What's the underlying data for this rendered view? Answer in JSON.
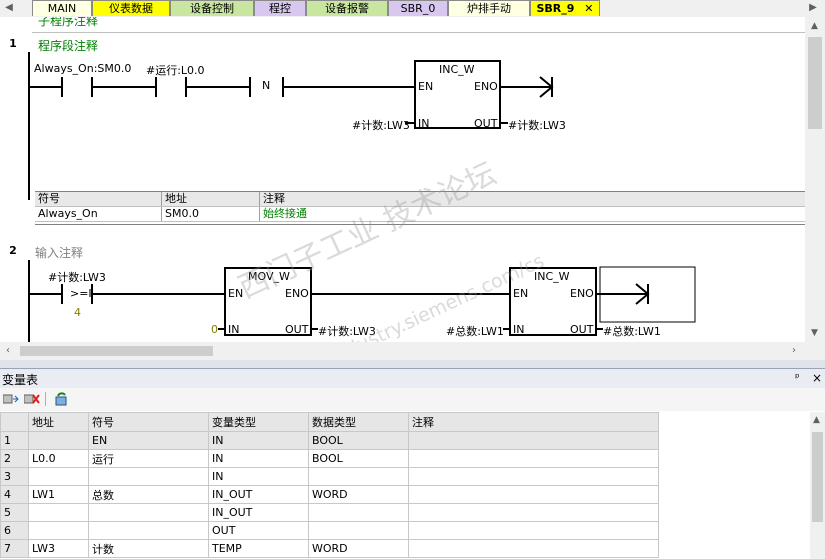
{
  "tabs": [
    {
      "label": "MAIN",
      "bg": "#ffffe1"
    },
    {
      "label": "仪表数据",
      "bg": "#ffff00"
    },
    {
      "label": "设备控制",
      "bg": "#c8e6a0"
    },
    {
      "label": "程控",
      "bg": "#d8c8f0"
    },
    {
      "label": "设备报警",
      "bg": "#c8e6a0"
    },
    {
      "label": "SBR_0",
      "bg": "#d8c8f0"
    },
    {
      "label": "炉排手动",
      "bg": "#ffffe1"
    },
    {
      "label": "SBR_9",
      "bg": "#ffff00"
    }
  ],
  "editor": {
    "top_partial_comment": "子程序注释",
    "network1": {
      "number": "1",
      "comment": "程序段注释",
      "contact1_label": "Always_On:SM0.0",
      "contact2_label": "#运行:L0.0",
      "n_label": "N",
      "box_title": "INC_W",
      "en": "EN",
      "eno": "ENO",
      "in": "IN",
      "out": "OUT",
      "in_operand": "#计数:LW3",
      "out_operand": "#计数:LW3",
      "symbol_table": {
        "headers": [
          "符号",
          "地址",
          "注释"
        ],
        "row": [
          "Always_On",
          "SM0.0",
          "始终接通"
        ]
      }
    },
    "network2": {
      "number": "2",
      "comment": "输入注释",
      "compare_label": "#计数:LW3",
      "compare_op": ">=I",
      "compare_value": "4",
      "mov_title": "MOV_W",
      "mov_in": "0",
      "mov_out": "#计数:LW3",
      "inc_title": "INC_W",
      "inc_in": "#总数:LW1",
      "inc_out": "#总数:LW1",
      "en": "EN",
      "eno": "ENO",
      "in": "IN",
      "out": "OUT"
    },
    "watermark": {
      "line1": "西门子工业 技术论坛",
      "line2": "support.industry.siemens.com/cs"
    }
  },
  "var_table": {
    "title": "变量表",
    "pin": "ᵖ",
    "close": "×",
    "headers": [
      "",
      "地址",
      "符号",
      "变量类型",
      "数据类型",
      "注释"
    ],
    "rows": [
      {
        "n": "1",
        "addr": "",
        "sym": "EN",
        "vtype": "IN",
        "dtype": "BOOL",
        "comment": ""
      },
      {
        "n": "2",
        "addr": "L0.0",
        "sym": "运行",
        "vtype": "IN",
        "dtype": "BOOL",
        "comment": ""
      },
      {
        "n": "3",
        "addr": "",
        "sym": "",
        "vtype": "IN",
        "dtype": "",
        "comment": ""
      },
      {
        "n": "4",
        "addr": "LW1",
        "sym": "总数",
        "vtype": "IN_OUT",
        "dtype": "WORD",
        "comment": ""
      },
      {
        "n": "5",
        "addr": "",
        "sym": "",
        "vtype": "IN_OUT",
        "dtype": "",
        "comment": ""
      },
      {
        "n": "6",
        "addr": "",
        "sym": "",
        "vtype": "OUT",
        "dtype": "",
        "comment": ""
      },
      {
        "n": "7",
        "addr": "LW3",
        "sym": "计数",
        "vtype": "TEMP",
        "dtype": "WORD",
        "comment": ""
      }
    ]
  }
}
